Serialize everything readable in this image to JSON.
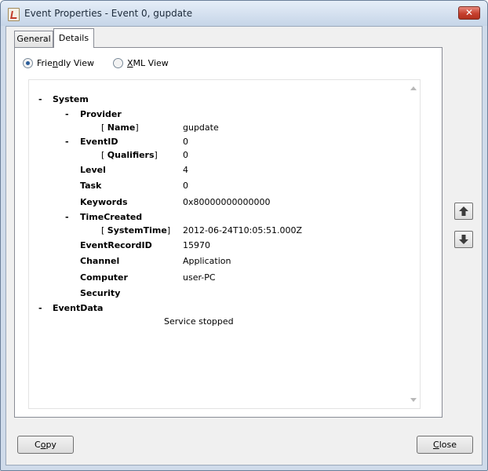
{
  "window": {
    "title": "Event Properties - Event 0, gupdate",
    "close_glyph": "✕"
  },
  "tabs": [
    {
      "label": "General",
      "active": false
    },
    {
      "label": "Details",
      "active": true
    }
  ],
  "view_options": {
    "friendly": {
      "pre": "Frie",
      "mnemonic": "n",
      "post": "dly View",
      "selected": true
    },
    "xml": {
      "pre": "",
      "mnemonic": "X",
      "post": "ML View",
      "selected": false
    }
  },
  "tree": {
    "minus": "-",
    "system": "System",
    "provider": "Provider",
    "name_key": {
      "open": "[ ",
      "label": "Name",
      "close": "]"
    },
    "name_val": "gupdate",
    "eventid": "EventID",
    "eventid_val": "0",
    "qualifiers_key": {
      "open": "[ ",
      "label": "Qualifiers",
      "close": "]"
    },
    "qualifiers_val": "0",
    "level": "Level",
    "level_val": "4",
    "task": "Task",
    "task_val": "0",
    "keywords": "Keywords",
    "keywords_val": "0x80000000000000",
    "timecreated": "TimeCreated",
    "systemtime_key": {
      "open": "[ ",
      "label": "SystemTime",
      "close": "]"
    },
    "systemtime_val": "2012-06-24T10:05:51.000Z",
    "eventrecordid": "EventRecordID",
    "eventrecordid_val": "15970",
    "channel": "Channel",
    "channel_val": "Application",
    "computer": "Computer",
    "computer_val": "user-PC",
    "security": "Security",
    "eventdata": "EventData",
    "eventdata_val": "Service stopped"
  },
  "buttons": {
    "copy": {
      "pre": "C",
      "mnemonic": "o",
      "post": "py"
    },
    "close": {
      "pre": "",
      "mnemonic": "C",
      "post": "lose"
    }
  },
  "icons": {
    "nav_up": "up-arrow-icon",
    "nav_down": "down-arrow-icon"
  }
}
